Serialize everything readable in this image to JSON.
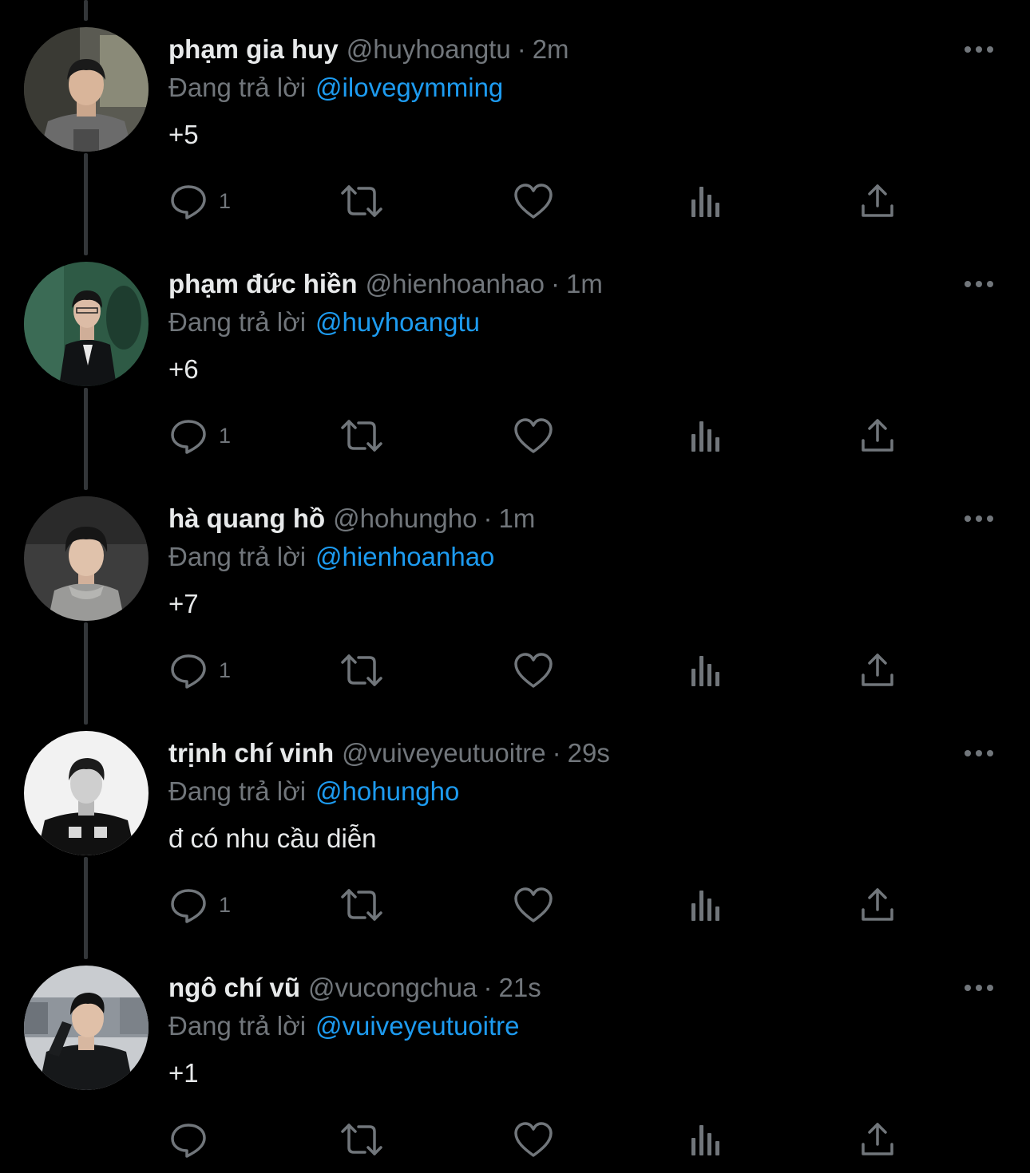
{
  "theme": {
    "background": "#000000",
    "text_primary": "#e7e9ea",
    "text_secondary": "#71767b",
    "accent": "#1d9bf0",
    "thread_line": "#333639"
  },
  "icons": {
    "reply": "reply-bubble-icon",
    "retweet": "retweet-icon",
    "like": "heart-icon",
    "views": "views-bar-chart-icon",
    "share": "share-upload-icon",
    "more": "more-dots-icon"
  },
  "reply_prefix": "Đang trả lời",
  "tweets": [
    {
      "name": "phạm gia huy",
      "handle": "@huyhoangtu",
      "separator": "·",
      "time": "2m",
      "reply_to": "@ilovegymming",
      "text": "+5",
      "reply_count": "1"
    },
    {
      "name": "phạm đức hiền",
      "handle": "@hienhoanhao",
      "separator": "·",
      "time": "1m",
      "reply_to": "@huyhoangtu",
      "text": "+6",
      "reply_count": "1"
    },
    {
      "name": "hà quang hồ",
      "handle": "@hohungho",
      "separator": "·",
      "time": "1m",
      "reply_to": "@hienhoanhao",
      "text": "+7",
      "reply_count": "1"
    },
    {
      "name": "trịnh chí vinh",
      "handle": "@vuiveyeutuoitre",
      "separator": "·",
      "time": "29s",
      "reply_to": "@hohungho",
      "text": "đ có nhu cầu diễn",
      "reply_count": "1"
    },
    {
      "name": "ngô chí vũ",
      "handle": "@vucongchua",
      "separator": "·",
      "time": "21s",
      "reply_to": "@vuiveyeutuoitre",
      "text": "+1",
      "reply_count": ""
    }
  ]
}
